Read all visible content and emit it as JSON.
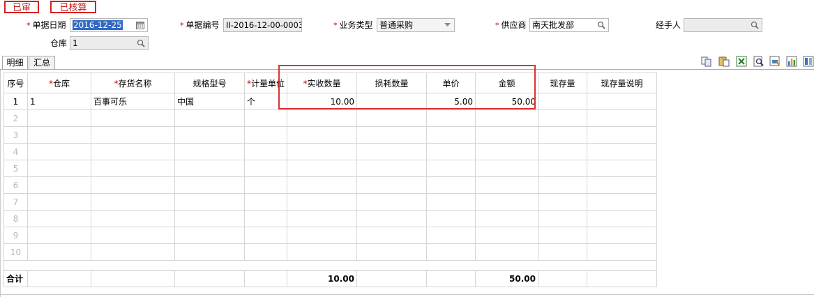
{
  "status": {
    "audited": "已审",
    "accounted": "已核算"
  },
  "form": {
    "date_label": "单据日期",
    "date_value": "2016-12-25",
    "number_label": "单据编号",
    "number_value": "II-2016-12-00-0003",
    "type_label": "业务类型",
    "type_value": "普通采购",
    "supplier_label": "供应商",
    "supplier_value": "南天批发部",
    "handler_label": "经手人",
    "handler_value": "",
    "warehouse_label": "仓库",
    "warehouse_value": "1"
  },
  "tabs": [
    {
      "label": "明细"
    },
    {
      "label": "汇总"
    }
  ],
  "toolbar_icons": [
    "copy-icon",
    "paste-icon",
    "excel-export-icon",
    "preview-icon",
    "print-icon",
    "chart-icon",
    "settings-icon"
  ],
  "table": {
    "headers": [
      "序号",
      "仓库",
      "存货名称",
      "规格型号",
      "计量单位",
      "实收数量",
      "损耗数量",
      "单价",
      "金额",
      "现存量",
      "现存量说明"
    ],
    "rows": [
      {
        "no": "1",
        "warehouse": "1",
        "name": "百事可乐",
        "spec": "中国",
        "unit": "个",
        "qty": "10.00",
        "loss": "",
        "price": "5.00",
        "amount": "50.00",
        "stock": "",
        "stock_note": ""
      }
    ],
    "empty_row_numbers": [
      "2",
      "3",
      "4",
      "5",
      "6",
      "7",
      "8",
      "9",
      "10"
    ],
    "total": {
      "label": "合计",
      "qty": "10.00",
      "amount": "50.00"
    }
  },
  "colors": {
    "stamp": "#d42020",
    "highlight": "#e03030",
    "selection": "#3169c6"
  }
}
